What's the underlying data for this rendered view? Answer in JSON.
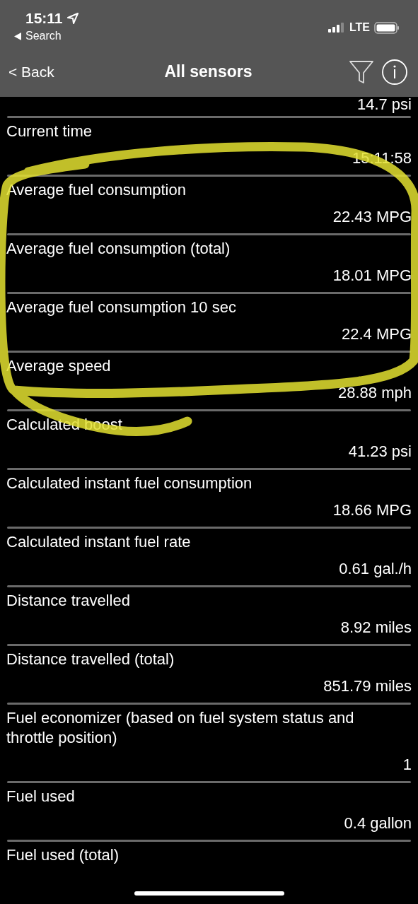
{
  "status_bar": {
    "time": "15:11",
    "return_app": "Search",
    "network": "LTE"
  },
  "nav_bar": {
    "back": "< Back",
    "title": "All sensors"
  },
  "sensors": [
    {
      "value": "14.7 psi"
    },
    {
      "name": "Current time",
      "value": "15:11:58"
    },
    {
      "name": "Average fuel consumption",
      "value": "22.43 MPG"
    },
    {
      "name": "Average fuel consumption (total)",
      "value": "18.01 MPG"
    },
    {
      "name": "Average fuel consumption 10 sec",
      "value": "22.4 MPG"
    },
    {
      "name": "Average speed",
      "value": "28.88 mph"
    },
    {
      "name": "Calculated boost",
      "value": "41.23 psi"
    },
    {
      "name": "Calculated instant fuel consumption",
      "value": "18.66 MPG"
    },
    {
      "name": "Calculated instant fuel rate",
      "value": "0.61 gal./h"
    },
    {
      "name": "Distance travelled",
      "value": "8.92 miles"
    },
    {
      "name": "Distance travelled (total)",
      "value": "851.79 miles"
    },
    {
      "name": "Fuel economizer (based on fuel system status and throttle position)",
      "value": "1"
    },
    {
      "name": "Fuel used",
      "value": "0.4 gallon"
    },
    {
      "name": "Fuel used (total)"
    }
  ]
}
